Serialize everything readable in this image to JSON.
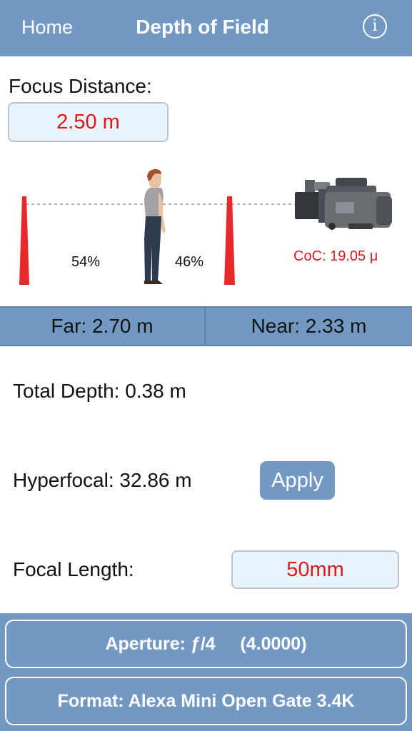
{
  "navbar": {
    "home_label": "Home",
    "title": "Depth of Field",
    "info_glyph": "i"
  },
  "focus": {
    "label": "Focus Distance:",
    "value": "2.50 m"
  },
  "diagram": {
    "far_percent": "54%",
    "near_percent": "46%",
    "coc": "CoC: 19.05 μ",
    "icons": [
      "far-cone-icon",
      "person-icon",
      "near-cone-icon",
      "camera-icon"
    ]
  },
  "results": {
    "far": "Far: 2.70 m",
    "near": "Near: 2.33 m"
  },
  "stats": {
    "total_depth": "Total Depth: 0.38 m",
    "hyperfocal": "Hyperfocal: 32.86 m",
    "apply_label": "Apply",
    "focal_label": "Focal Length:",
    "focal_value": "50mm"
  },
  "bottom": {
    "aperture": "Aperture: ƒ/4     (4.0000)",
    "format": "Format: Alexa Mini Open Gate 3.4K"
  },
  "colors": {
    "accent": "#7399c3",
    "value_red": "#d81b1b",
    "field_bg": "#e8f3fc",
    "cone_red": "#e8282a"
  }
}
